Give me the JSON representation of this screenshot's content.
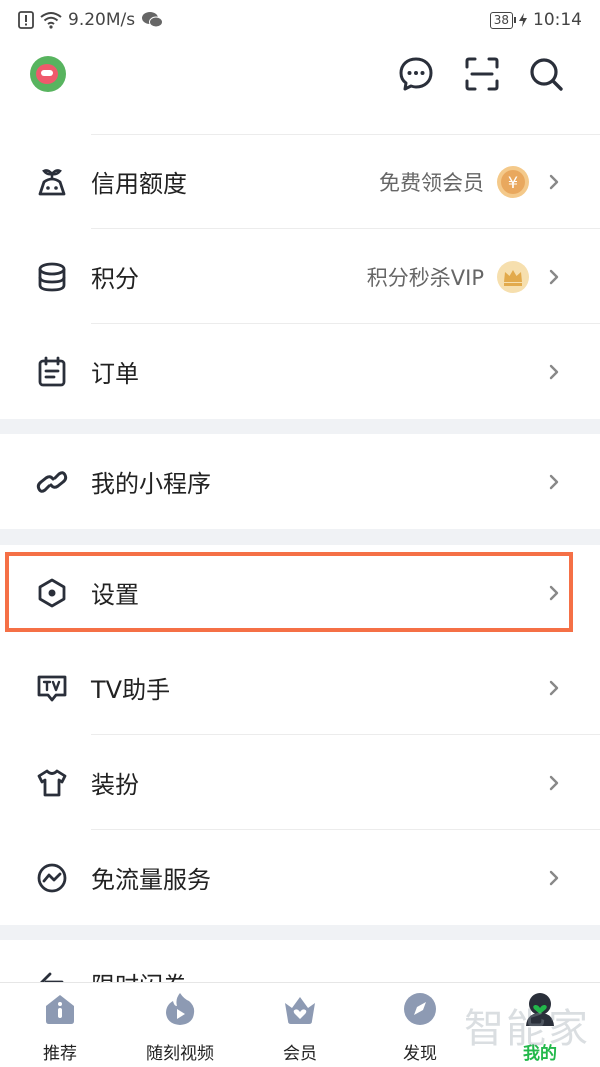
{
  "status": {
    "speed": "9.20M/s",
    "battery": "38",
    "time": "10:14"
  },
  "menu": {
    "section1": [
      {
        "label": "信用额度",
        "right_text": "免费领会员",
        "badge": "¥"
      },
      {
        "label": "积分",
        "right_text": "积分秒杀VIP",
        "badge": "crown"
      },
      {
        "label": "订单"
      }
    ],
    "section2": [
      {
        "label": "我的小程序"
      }
    ],
    "section3": [
      {
        "label": "设置"
      },
      {
        "label": "TV助手"
      },
      {
        "label": "装扮"
      },
      {
        "label": "免流量服务"
      }
    ],
    "partial_row": {
      "label": "限时闪券"
    }
  },
  "tabs": [
    {
      "label": "推荐",
      "icon": "home-icon"
    },
    {
      "label": "随刻视频",
      "icon": "flame-play-icon"
    },
    {
      "label": "会员",
      "icon": "crown-heart-icon"
    },
    {
      "label": "发现",
      "icon": "compass-icon"
    },
    {
      "label": "我的",
      "icon": "profile-icon",
      "active": true
    }
  ],
  "watermark": "智能家",
  "colors": {
    "accent_green": "#22b84a",
    "highlight_border": "#f57046",
    "icon_gray": "#8d9ab3"
  }
}
